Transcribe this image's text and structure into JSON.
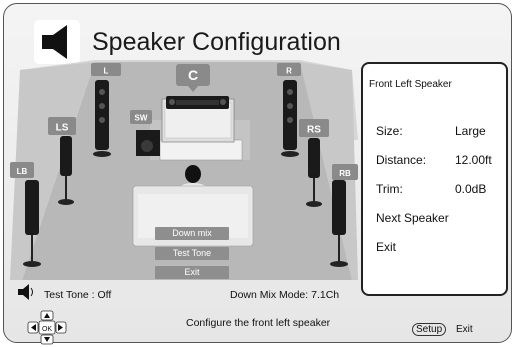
{
  "header": {
    "title": "Speaker Configuration",
    "icon": "speaker-icon"
  },
  "speakers": {
    "l": "L",
    "c": "C",
    "r": "R",
    "sw": "SW",
    "ls": "LS",
    "rs": "RS",
    "lb": "LB",
    "rb": "RB"
  },
  "menu": {
    "down_mix": "Down mix",
    "test_tone": "Test Tone",
    "exit": "Exit"
  },
  "status": {
    "test_tone": "Test Tone : Off",
    "down_mix_mode": "Down Mix Mode: 7.1Ch",
    "hint": "Configure the front left speaker"
  },
  "panel": {
    "title": "Front Left Speaker",
    "size_label": "Size:",
    "size_value": "Large",
    "distance_label": "Distance:",
    "distance_value": "12.00ft",
    "trim_label": "Trim:",
    "trim_value": "0.0dB",
    "next_speaker": "Next Speaker",
    "exit": "Exit"
  },
  "footer": {
    "setup_key": "Setup",
    "exit": "Exit",
    "nav_ok": "OK"
  },
  "colors": {
    "panel_border": "#222222",
    "floor": "#b8b8b8",
    "speaker_label_bg": "#8a8a8a",
    "menu_button_bg": "#8e8e8e"
  }
}
